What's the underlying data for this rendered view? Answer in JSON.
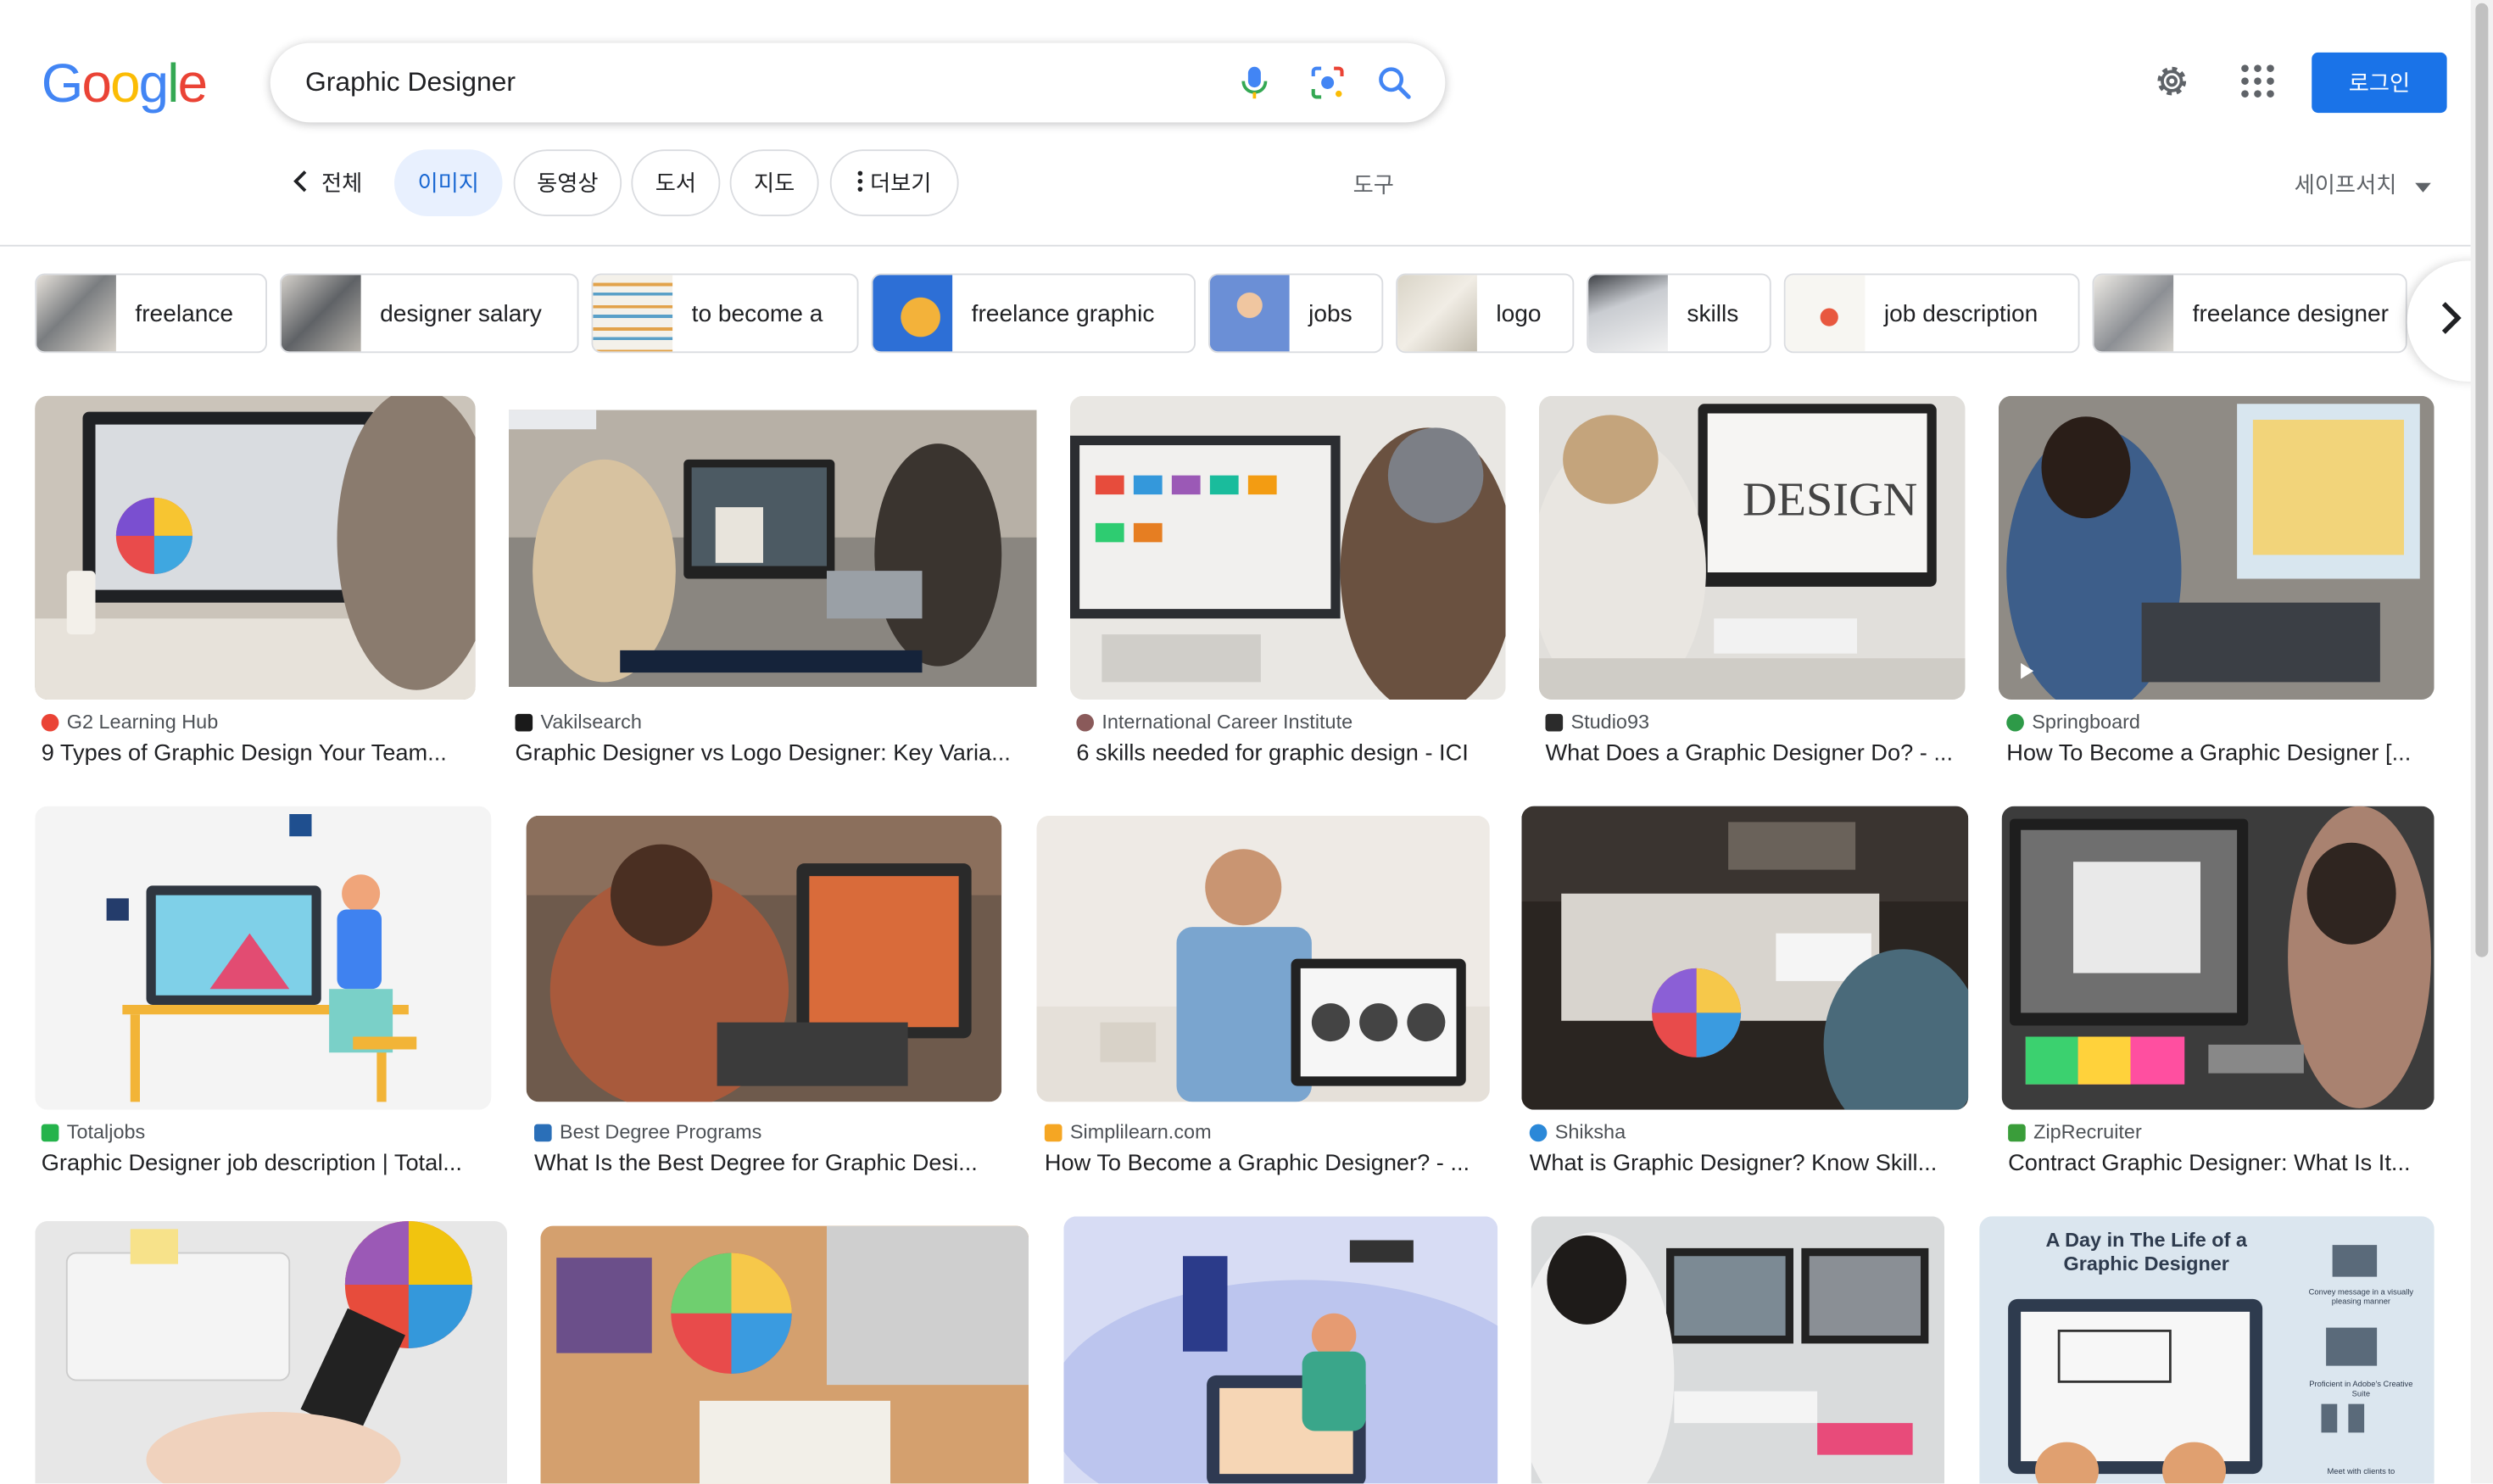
{
  "header": {
    "logo_letters": [
      "G",
      "o",
      "o",
      "g",
      "l",
      "e"
    ],
    "logo_colors": [
      "#4285F4",
      "#EA4335",
      "#FBBC05",
      "#4285F4",
      "#34A853",
      "#EA4335"
    ],
    "search_value": "Graphic Designer",
    "login_label": "로그인",
    "icons": [
      "mic-icon",
      "lens-icon",
      "search-icon",
      "gear-icon",
      "apps-grid-icon"
    ]
  },
  "tabs": {
    "back_label": "전체",
    "items": [
      "이미지",
      "동영상",
      "도서",
      "지도"
    ],
    "more_label": "더보기",
    "active": "이미지",
    "tools_label": "도구",
    "safesearch_label": "세이프서치"
  },
  "chips": [
    "freelance",
    "designer salary",
    "to become a",
    "freelance graphic",
    "jobs",
    "logo",
    "skills",
    "job description",
    "freelance designer"
  ],
  "results": [
    {
      "source": "G2 Learning Hub",
      "title": "9 Types of Graphic Design Your Team...",
      "fav_color": "#ea4335"
    },
    {
      "source": "Vakilsearch",
      "title": "Graphic Designer vs Logo Designer: Key Varia...",
      "fav_color": "#1a1a1a"
    },
    {
      "source": "International Career Institute",
      "title": "6 skills needed for graphic design - ICI",
      "fav_color": "#8a5a5a"
    },
    {
      "source": "Studio93",
      "title": "What Does a Graphic Designer Do? - ...",
      "fav_color": "#2b2b2b"
    },
    {
      "source": "Springboard",
      "title": "How To Become a Graphic Designer [...",
      "fav_color": "#2e9a48"
    },
    {
      "source": "Totaljobs",
      "title": "Graphic Designer job description | Total...",
      "fav_color": "#24b34b"
    },
    {
      "source": "Best Degree Programs",
      "title": "What Is the Best Degree for Graphic Desi...",
      "fav_color": "#2a6fb8"
    },
    {
      "source": "Simplilearn.com",
      "title": "How To Become a Graphic Designer? - ...",
      "fav_color": "#f5a623"
    },
    {
      "source": "Shiksha",
      "title": "What is Graphic Designer? Know Skill...",
      "fav_color": "#2b88d8"
    },
    {
      "source": "ZipRecruiter",
      "title": "Contract Graphic Designer: What Is It...",
      "fav_color": "#3a9d3a"
    }
  ],
  "infographic": {
    "heading": "A Day in The Life of a Graphic Designer",
    "lines": [
      "Convey message in a visually pleasing manner",
      "Proficient in Adobe's Creative Suite",
      "Meet with clients to"
    ]
  }
}
